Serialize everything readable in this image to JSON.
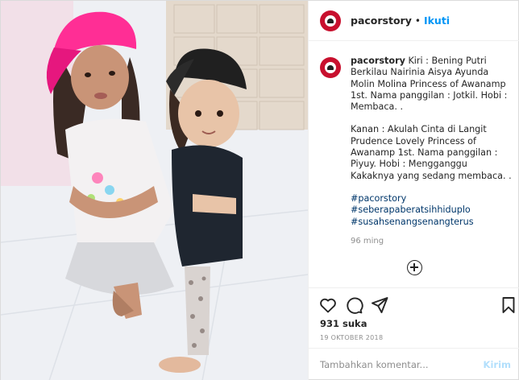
{
  "post": {
    "username": "pacorstory",
    "dot": "•",
    "follow_label": "Ikuti",
    "caption_user": "pacorstory",
    "caption_left": "Kiri : Bening Putri Berkilau Nairinia Aisya Ayunda Molin Molina Princess of Awanamp 1st. Nama panggilan : Jotkil. Hobi : Membaca. .",
    "caption_right": "Kanan : Akulah Cinta di Langit Prudence Lovely Princess of Awanamp 1st. Nama panggilan : Piyuy. Hobi : Mengganggu Kakaknya yang sedang membaca. .",
    "hashtags": [
      "#pacorstory",
      "#seberapaberatsihhiduplo",
      "#susahsenangsenangterus"
    ],
    "time_ago": "96 ming",
    "likes": "931 suka",
    "date": "19 OKTOBER 2018",
    "comment_placeholder": "Tambahkan komentar...",
    "send_label": "Kirim"
  },
  "icons": {
    "avatar": "pacorstory-logo-avatar",
    "more_comments": "plus-circle-icon",
    "like": "heart-icon",
    "comment": "speech-bubble-icon",
    "share": "paper-plane-icon",
    "save": "bookmark-icon"
  },
  "colors": {
    "link": "#0095f6",
    "hashtag": "#00376b",
    "muted": "#8e8e8e",
    "avatar_bg": "#c8102e",
    "pink_cap": "#ff2e95"
  }
}
